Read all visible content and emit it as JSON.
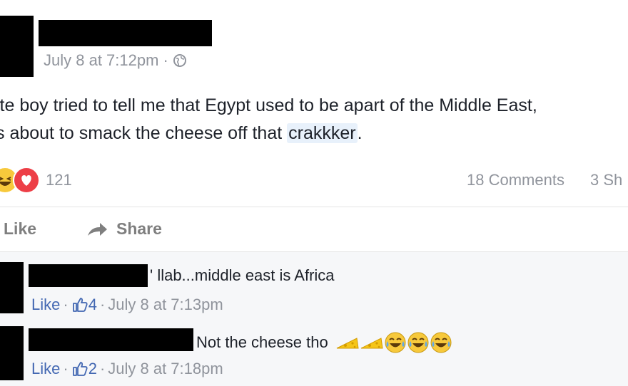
{
  "post": {
    "timestamp": "July 8 at 7:12pm",
    "separator": "·",
    "text_line1": "ite boy tried to tell me that Egypt used to be apart of the Middle East,",
    "text_line2_prefix": "s about to smack the cheese off that ",
    "text_highlight": "crakkker",
    "text_line2_suffix": ".",
    "reaction_count": "121",
    "comments_count": "18 Comments",
    "shares_count": "3 Sh"
  },
  "actions": {
    "like_label": "Like",
    "share_label": "Share"
  },
  "comments": [
    {
      "text": "' llab...middle east is Africa",
      "like_label": "Like",
      "like_count": "4",
      "time": "July 8 at 7:13pm"
    },
    {
      "text": "Not the cheese tho",
      "like_label": "Like",
      "like_count": "2",
      "time": "July 8 at 7:18pm"
    }
  ],
  "colors": {
    "link_blue": "#4267b2",
    "muted_gray": "#90949c",
    "highlight_bg": "#e8f1fb",
    "comment_bg": "#f6f7f9"
  }
}
